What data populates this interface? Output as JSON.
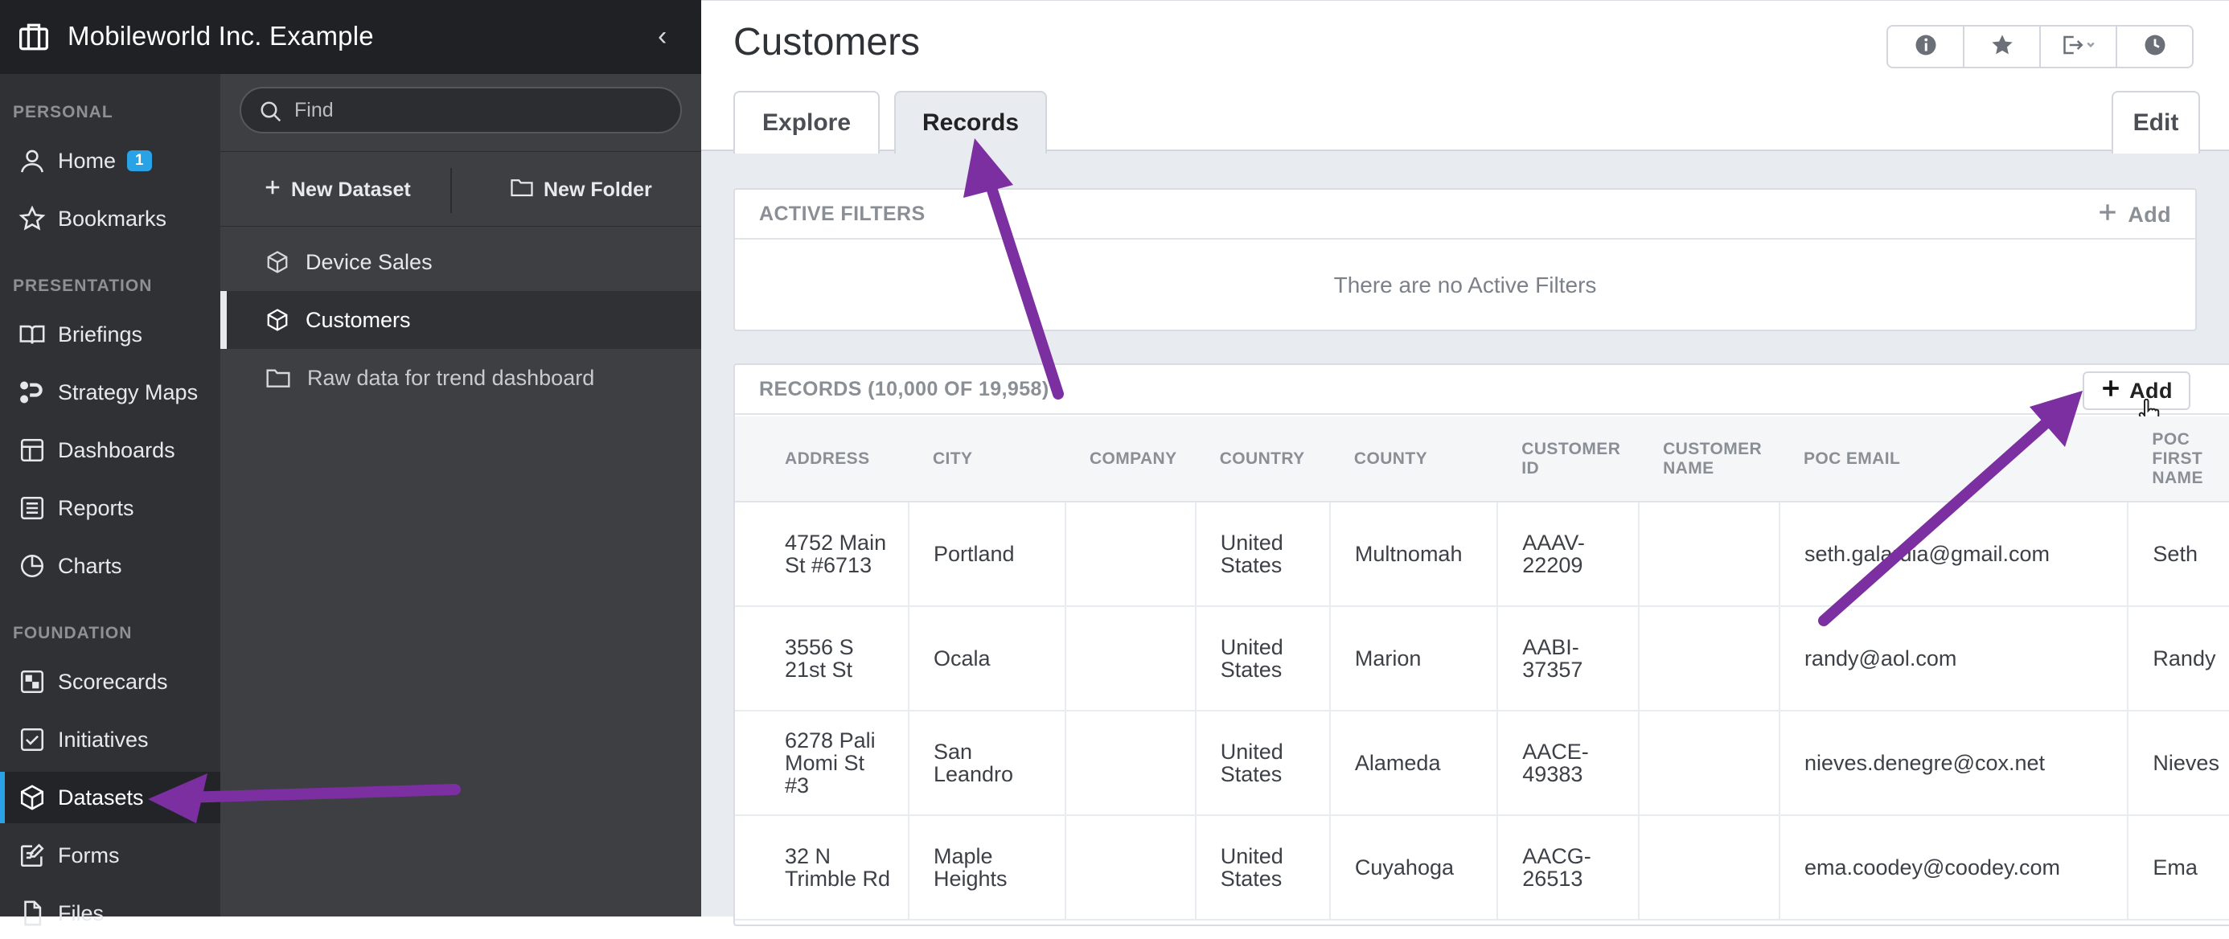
{
  "org": {
    "name": "Mobileworld Inc. Example"
  },
  "sidebar": {
    "sections": {
      "personal": "PERSONAL",
      "presentation": "PRESENTATION",
      "foundation": "FOUNDATION"
    },
    "items": [
      {
        "label": "Home",
        "icon": "user-icon",
        "badge": "1"
      },
      {
        "label": "Bookmarks",
        "icon": "star-outline-icon"
      },
      {
        "label": "Briefings",
        "icon": "book-icon"
      },
      {
        "label": "Strategy Maps",
        "icon": "strategy-map-icon"
      },
      {
        "label": "Dashboards",
        "icon": "dashboard-icon"
      },
      {
        "label": "Reports",
        "icon": "report-icon"
      },
      {
        "label": "Charts",
        "icon": "pie-chart-icon"
      },
      {
        "label": "Scorecards",
        "icon": "scorecard-icon"
      },
      {
        "label": "Initiatives",
        "icon": "checkbox-icon"
      },
      {
        "label": "Datasets",
        "icon": "cube-icon",
        "active": true
      },
      {
        "label": "Forms",
        "icon": "form-icon"
      },
      {
        "label": "Files",
        "icon": "file-icon"
      }
    ]
  },
  "panel": {
    "search_placeholder": "Find",
    "new_dataset_label": "New Dataset",
    "new_folder_label": "New Folder",
    "items": [
      {
        "label": "Device Sales",
        "icon": "cube-icon"
      },
      {
        "label": "Customers",
        "icon": "cube-icon",
        "active": true
      },
      {
        "label": "Raw data for trend dashboard",
        "icon": "folder-icon"
      }
    ]
  },
  "main": {
    "title": "Customers",
    "toolbar_icons": [
      "info-icon",
      "star-icon",
      "export-icon",
      "history-icon"
    ],
    "tabs": [
      {
        "label": "Explore",
        "active": false
      },
      {
        "label": "Records",
        "active": true
      }
    ],
    "edit_label": "Edit",
    "filters": {
      "header": "ACTIVE FILTERS",
      "add_label": "Add",
      "empty_text": "There are no Active Filters"
    },
    "records": {
      "header": "RECORDS (10,000 OF 19,958)",
      "add_label": "Add",
      "columns": [
        "ADDRESS",
        "CITY",
        "COMPANY",
        "COUNTRY",
        "COUNTY",
        "CUSTOMER ID",
        "CUSTOMER NAME",
        "POC EMAIL",
        "POC FIRST NAME"
      ],
      "rows": [
        [
          "4752 Main St #6713",
          "Portland",
          "",
          "United States",
          "Multnomah",
          "AAAV-22209",
          "",
          "seth.galardia@gmail.com",
          "Seth"
        ],
        [
          "3556 S 21st St",
          "Ocala",
          "",
          "United States",
          "Marion",
          "AABI-37357",
          "",
          "randy@aol.com",
          "Randy"
        ],
        [
          "6278 Pali Momi St #3",
          "San Leandro",
          "",
          "United States",
          "Alameda",
          "AACE-49383",
          "",
          "nieves.denegre@cox.net",
          "Nieves"
        ],
        [
          "32 N Trimble Rd",
          "Maple Heights",
          "",
          "United States",
          "Cuyahoga",
          "AACG-26513",
          "",
          "ema.coodey@coodey.com",
          "Ema"
        ]
      ]
    }
  },
  "colors": {
    "accent": "#2aa3e6",
    "annotation_arrow": "#7b2fa0"
  }
}
